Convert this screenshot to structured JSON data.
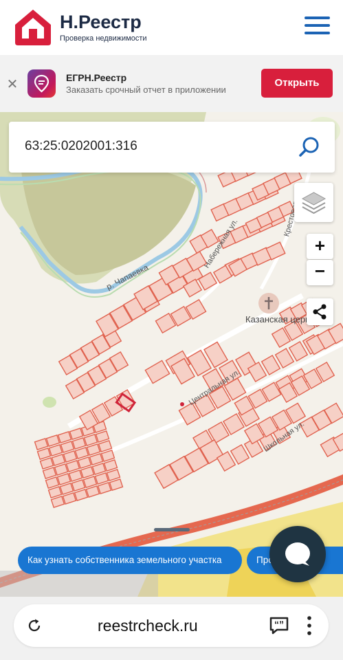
{
  "header": {
    "title": "Н.Реестр",
    "subtitle": "Проверка недвижимости"
  },
  "banner": {
    "app_name": "ЕГРН.Реестр",
    "description": "Заказать срочный отчет в приложении",
    "open_label": "Открыть"
  },
  "search": {
    "value": "63:25:0202001:316"
  },
  "map": {
    "labels": {
      "river": "р. Чапаевка",
      "church": "Казанская церковь",
      "street_central": "Центральная ул.",
      "street_school": "Школьная ул.",
      "street_embankment": "Набережная ул.",
      "street_cross": "Крестовая ул.",
      "street_short": "Ш"
    },
    "controls": {
      "zoom_in": "+",
      "zoom_out": "−"
    }
  },
  "chips": [
    {
      "label": "Как узнать собственника земельного участка"
    },
    {
      "label": "Проверка"
    }
  ],
  "browser": {
    "url": "reestrcheck.ru"
  },
  "colors": {
    "brand_red": "#d81f3c",
    "brand_blue": "#1b63b4",
    "parcel_stroke": "#e0624f",
    "highlight": "#d0243a"
  }
}
